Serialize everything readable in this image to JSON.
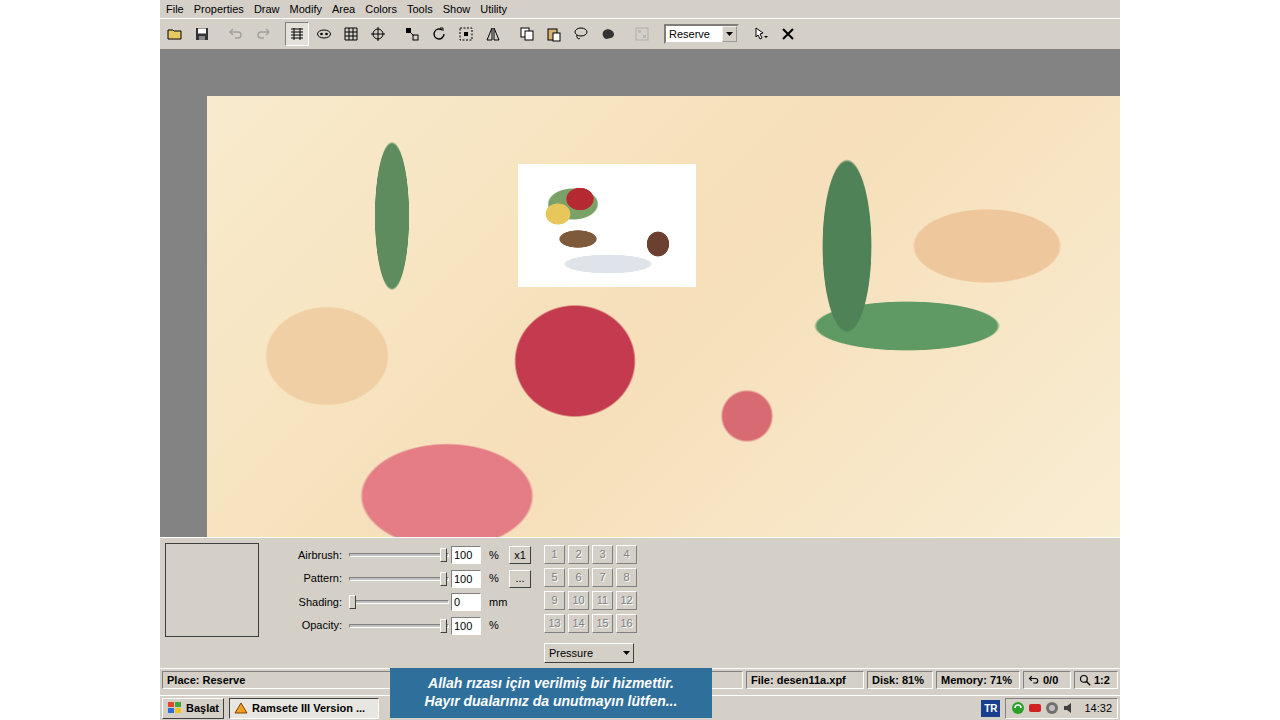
{
  "window": {
    "menu": [
      "File",
      "Properties",
      "Draw",
      "Modify",
      "Area",
      "Colors",
      "Tools",
      "Show",
      "Utility"
    ]
  },
  "toolbar": {
    "groups": [
      [
        {
          "disabled": false,
          "pressed": false
        },
        {
          "disabled": false,
          "pressed": false
        }
      ],
      [
        {
          "disabled": true,
          "pressed": false
        },
        {
          "disabled": true,
          "pressed": false
        }
      ],
      [
        {
          "disabled": false,
          "pressed": true
        },
        {
          "disabled": false,
          "pressed": false
        },
        {
          "disabled": false,
          "pressed": false
        },
        {
          "disabled": false,
          "pressed": false
        }
      ],
      [
        {
          "disabled": false,
          "pressed": false
        },
        {
          "disabled": false,
          "pressed": false
        },
        {
          "disabled": false,
          "pressed": false
        },
        {
          "disabled": false,
          "pressed": false
        }
      ],
      [
        {
          "disabled": false,
          "pressed": false
        },
        {
          "disabled": false,
          "pressed": false
        },
        {
          "disabled": false,
          "pressed": false
        },
        {
          "disabled": false,
          "pressed": false
        }
      ],
      [
        {
          "disabled": true,
          "pressed": false
        }
      ]
    ],
    "dropdown": "Reserve",
    "end_buttons": [
      {
        "disabled": false,
        "pressed": false
      },
      {
        "disabled": false,
        "pressed": false
      }
    ]
  },
  "controls": {
    "sliders": [
      {
        "label": "Airbrush:",
        "value": "100",
        "unit": "%",
        "level": 1.0,
        "button": "x1"
      },
      {
        "label": "Pattern:",
        "value": "100",
        "unit": "%",
        "level": 1.0,
        "button": "..."
      },
      {
        "label": "Shading:",
        "value": "0",
        "unit": "mm",
        "level": 0.0,
        "button": ""
      },
      {
        "label": "Opacity:",
        "value": "100",
        "unit": "%",
        "level": 1.0,
        "button": ""
      }
    ],
    "number_buttons": [
      {
        "label": "1",
        "disabled": true
      },
      {
        "label": "2",
        "disabled": true
      },
      {
        "label": "3",
        "disabled": true
      },
      {
        "label": "4",
        "disabled": true
      },
      {
        "label": "5",
        "disabled": true
      },
      {
        "label": "6",
        "disabled": true
      },
      {
        "label": "7",
        "disabled": true
      },
      {
        "label": "8",
        "disabled": true
      },
      {
        "label": "9",
        "disabled": true
      },
      {
        "label": "10",
        "disabled": true
      },
      {
        "label": "11",
        "disabled": true
      },
      {
        "label": "12",
        "disabled": true
      },
      {
        "label": "13",
        "disabled": true
      },
      {
        "label": "14",
        "disabled": true
      },
      {
        "label": "15",
        "disabled": true
      },
      {
        "label": "16",
        "disabled": true
      }
    ],
    "mode": "Pressure"
  },
  "status_bar": {
    "place": "Place: Reserve",
    "file": "File: desen11a.xpf",
    "disk": "Disk: 81%",
    "memory": "Memory: 71%",
    "undo": "0/0",
    "zoom": "1:2"
  },
  "taskbar": {
    "start": "Başlat",
    "tasks": [
      {
        "label": "Ramsete III  Version ...",
        "selected": true
      }
    ],
    "language": "TR",
    "clock": "14:32"
  },
  "caption": [
    "Allah rızası için verilmiş bir hizmettir.",
    "Hayır dualarınız da unutmayın lütfen..."
  ]
}
